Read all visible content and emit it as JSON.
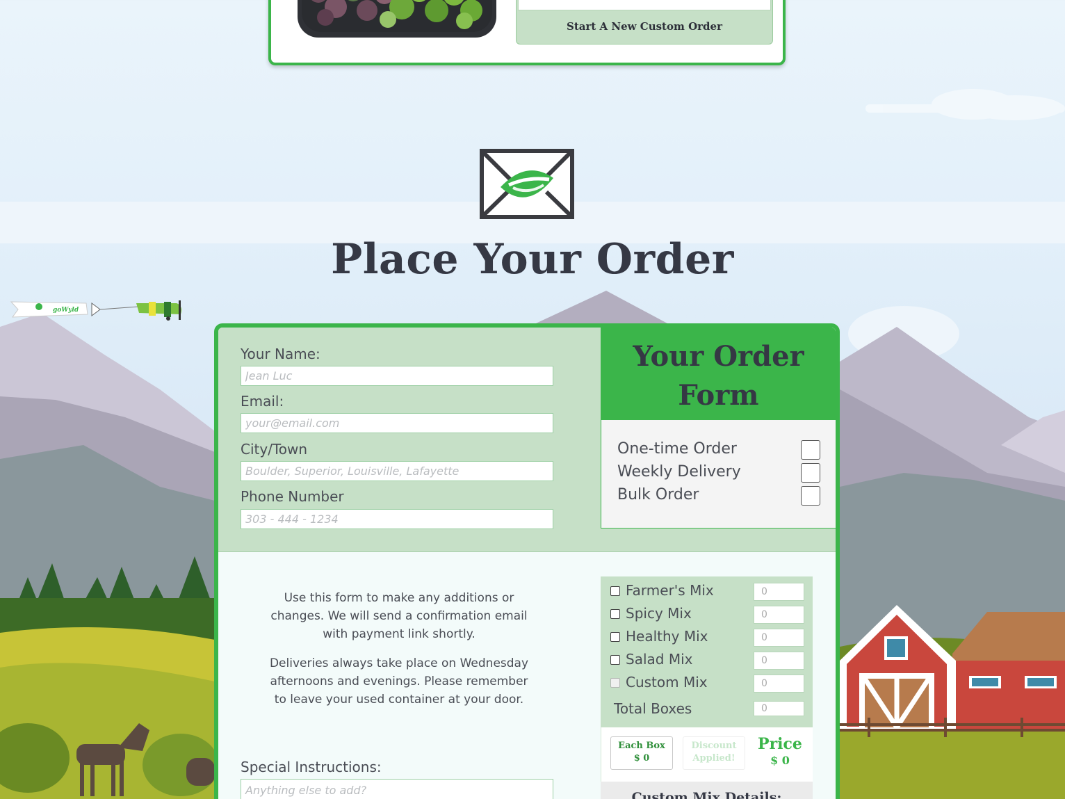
{
  "top_card": {
    "start_custom_order_label": "Start A New Custom Order"
  },
  "plane_banner_text": "goWyld",
  "page_title": "Place Your Order",
  "form": {
    "fields": [
      {
        "label": "Your Name:",
        "placeholder": "Jean Luc"
      },
      {
        "label": "Email:",
        "placeholder": "your@email.com"
      },
      {
        "label": "City/Town",
        "placeholder": "Boulder, Superior, Louisville, Lafayette"
      },
      {
        "label": "Phone Number",
        "placeholder": "303 - 444 - 1234"
      }
    ],
    "order_form_title": "Your Order Form",
    "order_types": [
      {
        "label": "One-time Order",
        "checked": false
      },
      {
        "label": "Weekly Delivery",
        "checked": false
      },
      {
        "label": "Bulk Order",
        "checked": false
      }
    ],
    "description_1": "Use this form to make any additions or changes. We will send a confirmation email with payment link shortly.",
    "description_2": "Deliveries always take place on Wednesday afternoons and evenings. Please remember to leave your used container at your door.",
    "special_instructions": {
      "label": "Special Instructions:",
      "placeholder": "Anything else to add?"
    },
    "mixes": [
      {
        "label": "Farmer's Mix",
        "qty": "0",
        "disabled": false
      },
      {
        "label": "Spicy Mix",
        "qty": "0",
        "disabled": false
      },
      {
        "label": "Healthy Mix",
        "qty": "0",
        "disabled": false
      },
      {
        "label": "Salad Mix",
        "qty": "0",
        "disabled": false
      },
      {
        "label": "Custom Mix",
        "qty": "0",
        "disabled": true
      }
    ],
    "total_boxes": {
      "label": "Total Boxes",
      "value": "0"
    },
    "each_box": {
      "label": "Each Box",
      "value": "$ 0"
    },
    "discount": {
      "label": "Discount Applied!"
    },
    "price": {
      "label": "Price",
      "value": "$ 0"
    },
    "custom_mix_details_title": "Custom Mix Details:"
  },
  "colors": {
    "brand_green": "#3bb54a",
    "panel_green": "#c6e0c7",
    "heading_dark": "#353844",
    "barn_red": "#c9473d"
  }
}
